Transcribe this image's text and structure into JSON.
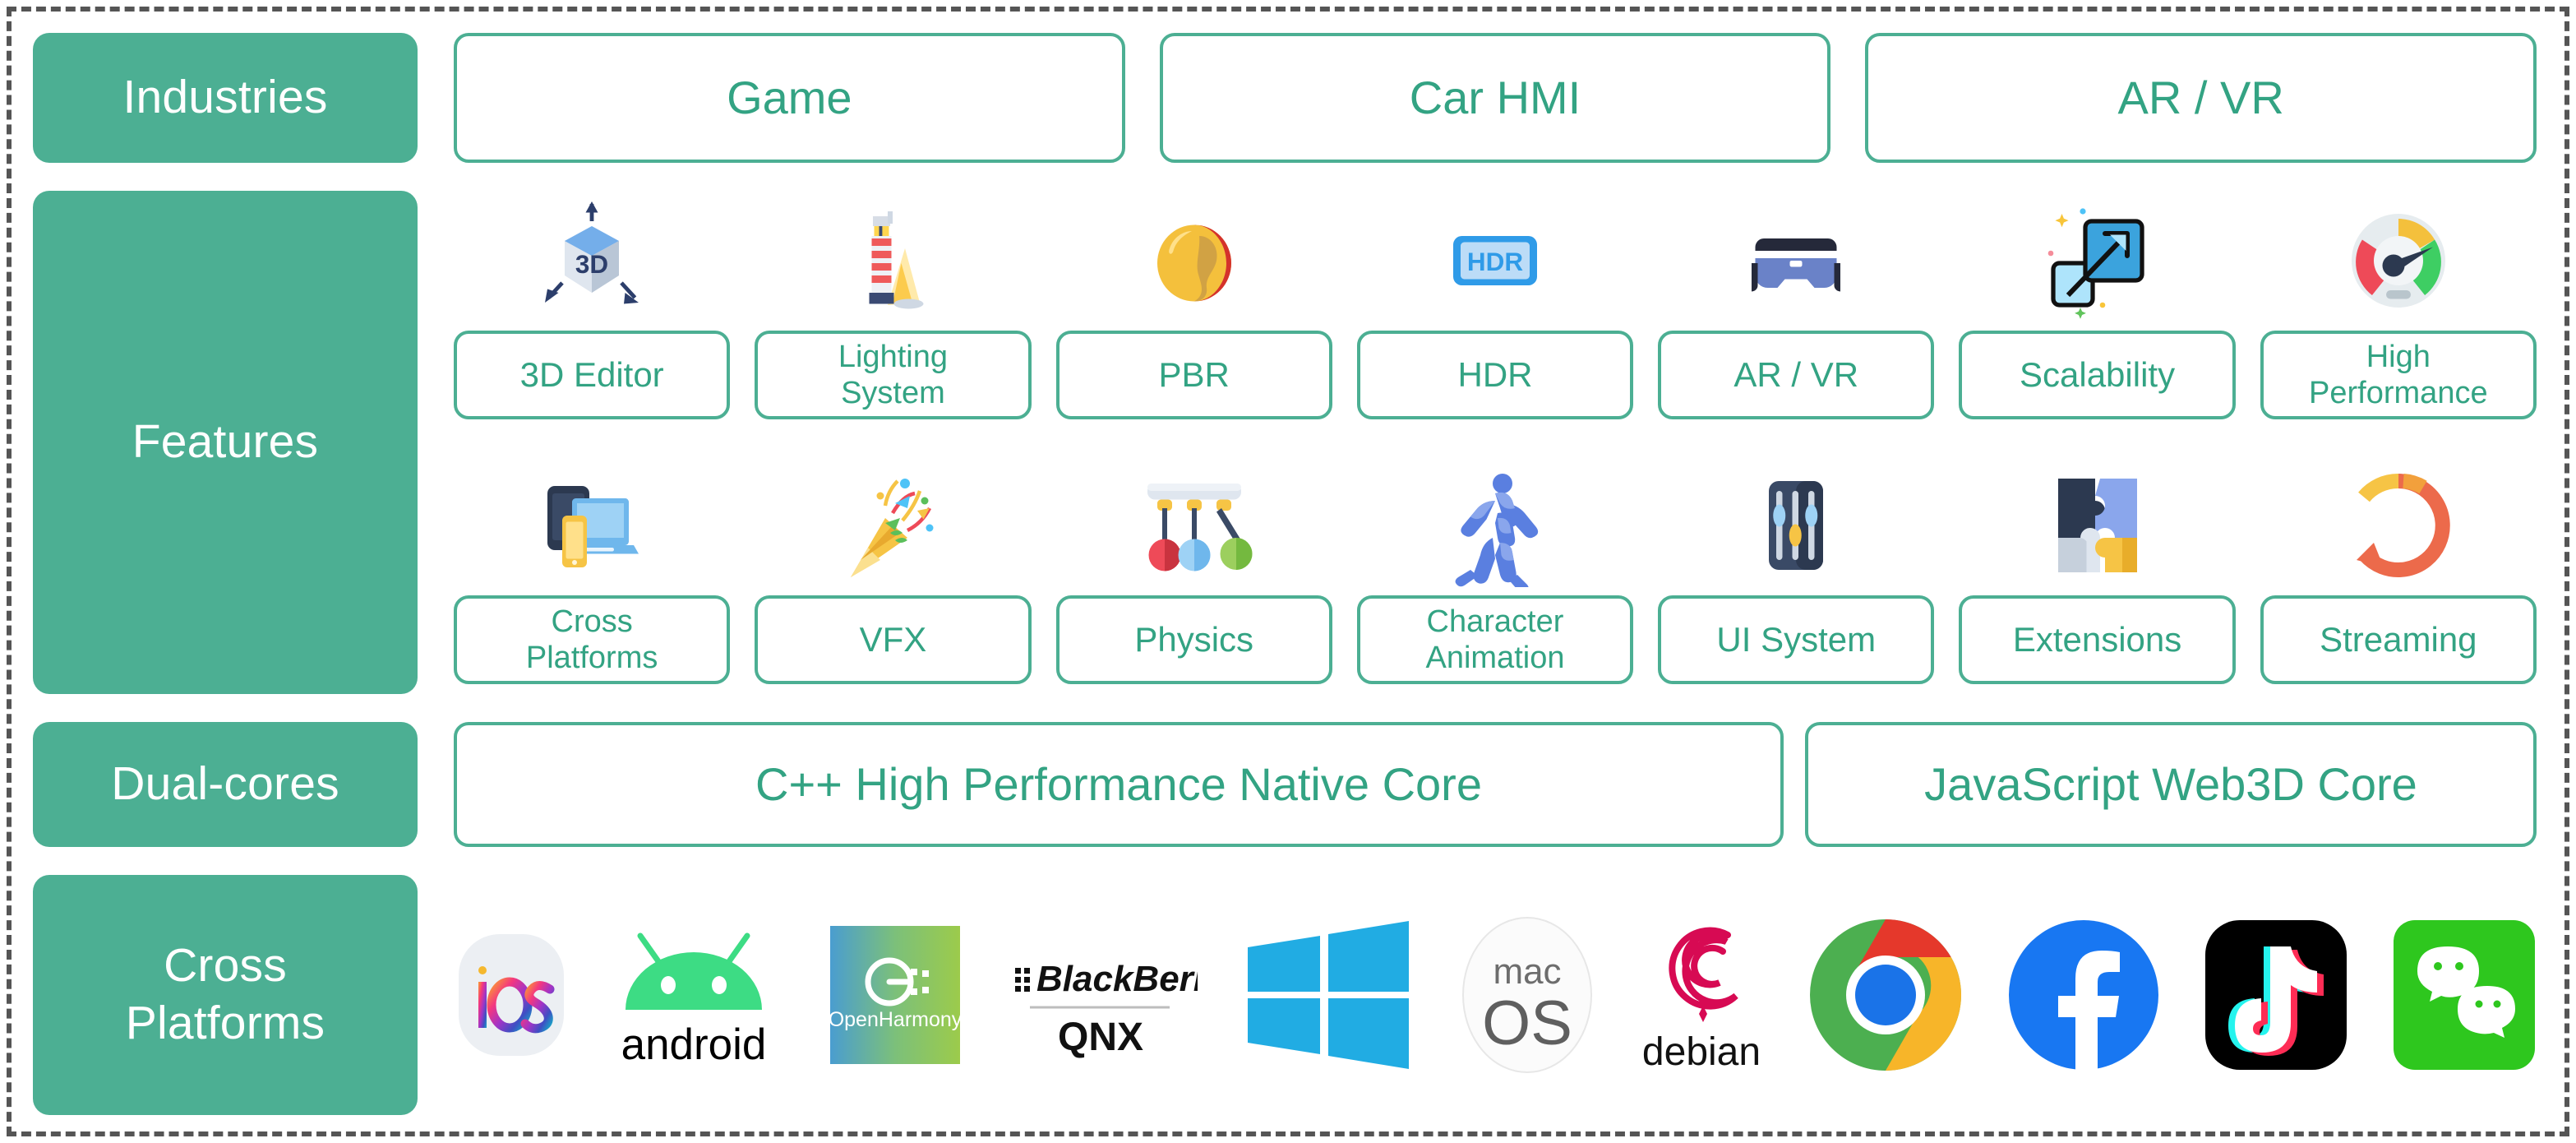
{
  "theme": {
    "accent": "#4CAF93",
    "accent_text": "#33A383",
    "border_dashed": "#555555",
    "label_text": "#FFFFFF",
    "background": "#FFFFFF"
  },
  "rows": {
    "industries": {
      "label": "Industries",
      "items": [
        {
          "label": "Game"
        },
        {
          "label": "Car HMI"
        },
        {
          "label": "AR / VR"
        }
      ]
    },
    "features": {
      "label": "Features",
      "row1": [
        {
          "label": "3D Editor",
          "icon": "3d-cube-icon"
        },
        {
          "label": "Lighting\nSystem",
          "icon": "lighthouse-icon"
        },
        {
          "label": "PBR",
          "icon": "paint-blob-icon"
        },
        {
          "label": "HDR",
          "icon": "hdr-badge-icon"
        },
        {
          "label": "AR / VR",
          "icon": "vr-headset-icon"
        },
        {
          "label": "Scalability",
          "icon": "scale-up-arrow-icon"
        },
        {
          "label": "High\nPerformance",
          "icon": "speedometer-icon"
        }
      ],
      "row2": [
        {
          "label": "Cross\nPlatforms",
          "icon": "multi-device-icon"
        },
        {
          "label": "VFX",
          "icon": "party-popper-icon"
        },
        {
          "label": "Physics",
          "icon": "newtons-cradle-icon"
        },
        {
          "label": "Character\nAnimation",
          "icon": "running-figure-icon"
        },
        {
          "label": "UI System",
          "icon": "sliders-icon"
        },
        {
          "label": "Extensions",
          "icon": "puzzle-pieces-icon"
        },
        {
          "label": "Streaming",
          "icon": "circular-refresh-arrow-icon"
        }
      ]
    },
    "dual_cores": {
      "label": "Dual-cores",
      "items": [
        {
          "label": "C++ High Performance Native Core"
        },
        {
          "label": "JavaScript Web3D Core"
        }
      ]
    },
    "cross_platforms": {
      "label": "Cross\nPlatforms",
      "items": [
        {
          "name": "ios-logo",
          "text": "iOS"
        },
        {
          "name": "android-logo",
          "text": "android"
        },
        {
          "name": "openharmony-logo",
          "text": "OpenHarmony"
        },
        {
          "name": "blackberry-qnx-logo",
          "text": "BlackBerry",
          "text2": "QNX"
        },
        {
          "name": "windows-logo",
          "text": ""
        },
        {
          "name": "macos-logo",
          "text": "mac",
          "text2": "OS"
        },
        {
          "name": "debian-logo",
          "text": "debian"
        },
        {
          "name": "chrome-logo",
          "text": ""
        },
        {
          "name": "facebook-logo",
          "text": ""
        },
        {
          "name": "tiktok-logo",
          "text": ""
        },
        {
          "name": "wechat-logo",
          "text": ""
        }
      ]
    }
  }
}
